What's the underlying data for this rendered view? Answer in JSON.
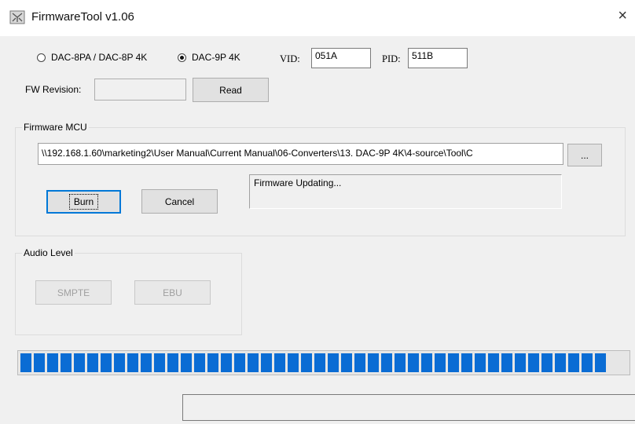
{
  "window": {
    "title": "FirmwareTool v1.06",
    "close_glyph": "×",
    "icon": "firmware-tool-icon"
  },
  "device": {
    "options": [
      {
        "label": "DAC-8PA / DAC-8P 4K",
        "checked": false
      },
      {
        "label": "DAC-9P 4K",
        "checked": true
      }
    ],
    "vid_label": "VID:",
    "vid_value": "051A",
    "pid_label": "PID:",
    "pid_value": "511B",
    "fw_revision_label": "FW Revision:",
    "fw_revision_value": "",
    "read_label": "Read"
  },
  "firmware_mcu": {
    "title": "Firmware MCU",
    "path": "\\\\192.168.1.60\\marketing2\\User Manual\\Current Manual\\06-Converters\\13. DAC-9P 4K\\4-source\\Tool\\C",
    "browse_label": "...",
    "burn_label": "Burn",
    "cancel_label": "Cancel",
    "status_message": "Firmware Updating..."
  },
  "audio_level": {
    "title": "Audio Level",
    "smpte_label": "SMPTE",
    "ebu_label": "EBU"
  },
  "progress": {
    "fraction": 0.965,
    "color": "#0a6cd4"
  },
  "status_bar": {
    "text": ""
  }
}
